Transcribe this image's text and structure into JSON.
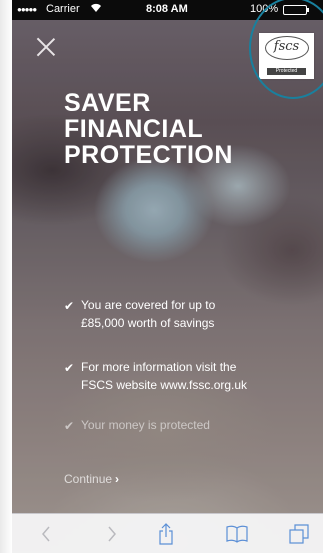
{
  "status_bar": {
    "signal": "●●●●●",
    "carrier": "Carrier",
    "wifi_icon": "wifi-icon",
    "time": "8:08 AM",
    "battery": "100%"
  },
  "badge": {
    "logo_text": "fscs",
    "protected_label": "Protected"
  },
  "headline": [
    "SAVER",
    "FINANCIAL",
    "PROTECTION"
  ],
  "bullets": [
    {
      "lines": [
        "You are covered for up to",
        "£85,000 worth of savings"
      ]
    },
    {
      "lines": [
        "For more information visit the",
        "FSCS website www.fssc.org.uk"
      ]
    },
    {
      "lines": [
        "Your money is protected"
      ]
    }
  ],
  "continue": {
    "label": "Continue",
    "chevron": "›"
  },
  "toolbar": [
    "back-icon",
    "forward-icon",
    "share-icon",
    "bookmarks-icon",
    "tabs-icon"
  ],
  "colors": {
    "highlight_ring": "#19809e",
    "battery_fill": "#4cd964"
  }
}
